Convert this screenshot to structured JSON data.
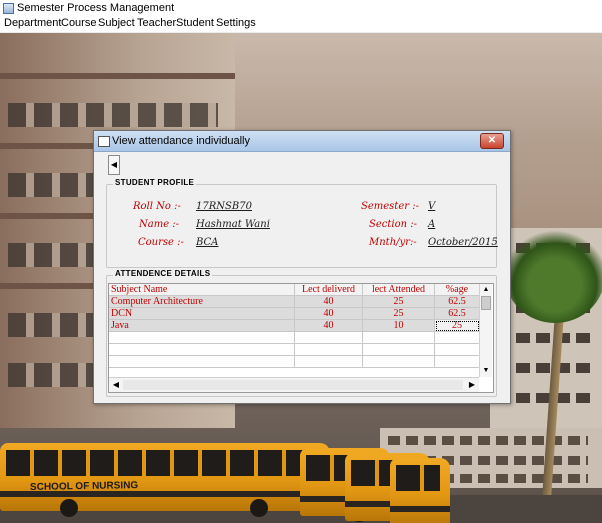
{
  "app": {
    "title": "Semester Process Management"
  },
  "menu": {
    "items": [
      "Department",
      "Course",
      "Subject",
      "Teacher",
      "Student",
      "Settings"
    ]
  },
  "background": {
    "bus_text": "SCHOOL OF NURSING"
  },
  "dialog": {
    "title": "View attendance individually",
    "close_glyph": "✕",
    "back_glyph": "◀",
    "profile": {
      "heading": "STUDENT PROFILE",
      "roll_label": "Roll No :-",
      "roll_value": "17RNSB70",
      "name_label": "Name :-",
      "name_value": "Hashmat Wani",
      "course_label": "Course :-",
      "course_value": "BCA",
      "semester_label": "Semester :-",
      "semester_value": "V",
      "section_label": "Section :-",
      "section_value": "A",
      "month_label": "Mnth/yr:-",
      "month_value": "October/2015"
    },
    "attendance": {
      "heading": "ATTENDENCE DETAILS",
      "columns": [
        "Subject Name",
        "Lect deliverd",
        "lect Attended",
        "%age"
      ],
      "rows": [
        [
          "Computer Architecture",
          "40",
          "25",
          "62.5"
        ],
        [
          "DCN",
          "40",
          "25",
          "62.5"
        ],
        [
          "Java",
          "40",
          "10",
          "25"
        ]
      ],
      "scroll": {
        "up": "▲",
        "down": "▼",
        "left": "◀",
        "right": "▶"
      }
    }
  }
}
